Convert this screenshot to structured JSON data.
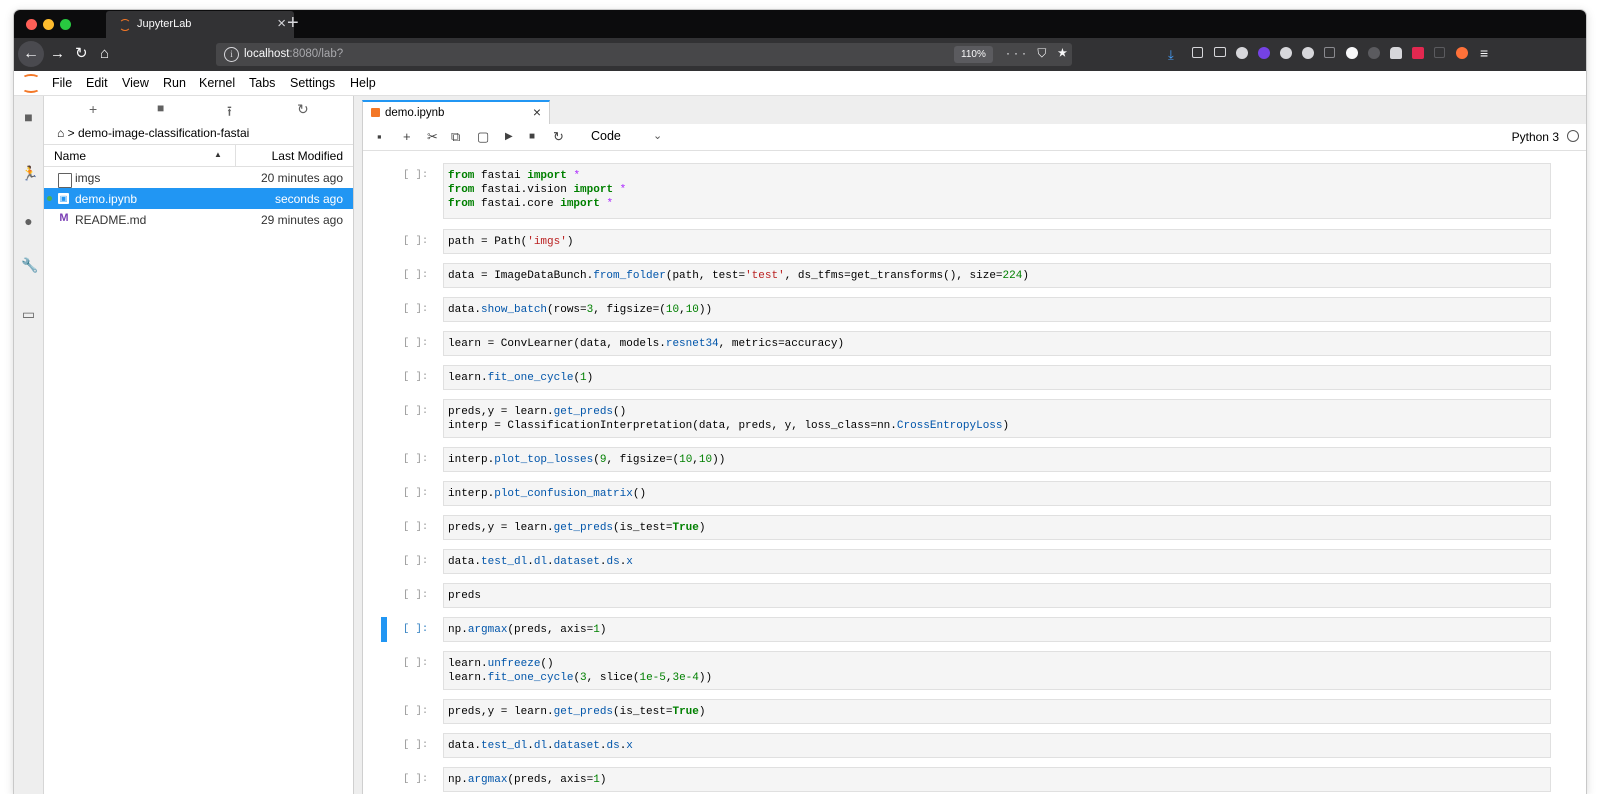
{
  "browser": {
    "tab_title": "JupyterLab",
    "tab_close": "×",
    "new_tab": "+",
    "url_host": "localhost",
    "url_rest": ":8080/lab?",
    "zoom": "110%",
    "url_actions": "··· ⛉ ★"
  },
  "menu": {
    "items": [
      "File",
      "Edit",
      "View",
      "Run",
      "Kernel",
      "Tabs",
      "Settings",
      "Help"
    ]
  },
  "filebrowser": {
    "breadcrumb": "demo-image-classification-fastai",
    "col_name": "Name",
    "col_modified": "Last Modified",
    "files": [
      {
        "name": "imgs",
        "modified": "20 minutes ago",
        "type": "folder"
      },
      {
        "name": "demo.ipynb",
        "modified": "seconds ago",
        "type": "notebook"
      },
      {
        "name": "README.md",
        "modified": "29 minutes ago",
        "type": "markdown"
      }
    ]
  },
  "notebook": {
    "tab_title": "demo.ipynb",
    "tab_close": "×",
    "cell_type": "Code",
    "kernel": "Python 3",
    "prompt": "[ ]:"
  },
  "colors": {
    "accent": "#2196f3",
    "jupyter_orange": "#f37726",
    "browser_dark": "#0c0c0d",
    "browser_toolbar": "#323234"
  }
}
